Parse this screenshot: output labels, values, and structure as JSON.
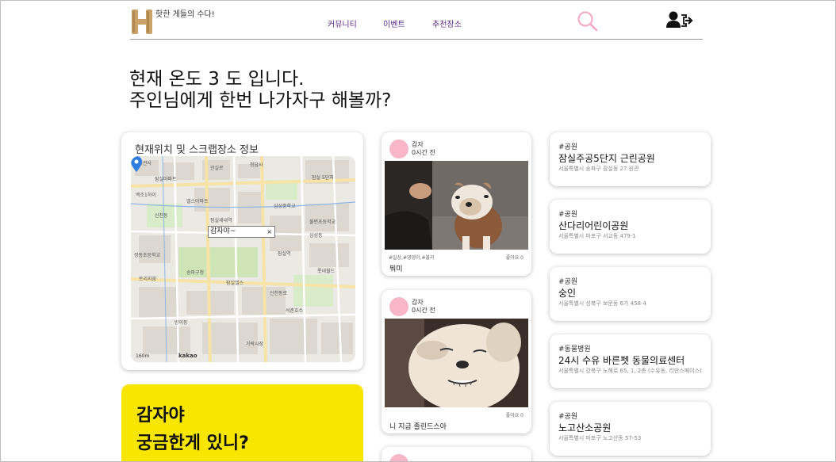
{
  "header": {
    "tagline": "핫한 게들의 수다!",
    "nav": [
      "커뮤니티",
      "이벤트",
      "추천장소"
    ],
    "colors": {
      "nav": "#5b2a86",
      "logo": "#c8a268",
      "search": "#f5a7bf"
    }
  },
  "greeting": {
    "line1": "현재 온도 3 도 입니다.",
    "line2": "주인님에게 한번 나가자구 해볼까?"
  },
  "map_card": {
    "title": "현재위치 및 스크랩장소 정보",
    "info_label": "감자야~",
    "info_close": "×",
    "labels": [
      "체육관사",
      "잠실아파트",
      "청담사",
      "백조1하이",
      "관실로",
      "잠실 5단지",
      "엘스아파트",
      "삼성중학교",
      "신천동",
      "잠실새내역",
      "불변초등학교",
      "정동초등학교",
      "삼성동",
      "잠실역",
      "롯데월드",
      "송파구청",
      "트리지움",
      "잠실엘스",
      "신천동로",
      "방이동",
      "석촌호수",
      "가락시장"
    ],
    "scale": "160m",
    "kakao": "kakao"
  },
  "yellow_card": {
    "line1": "감자야",
    "line2": "궁금한게 있니?",
    "color": "#f7e600"
  },
  "posts": [
    {
      "author": "감자",
      "time": "0시간 전",
      "tags": "#일상,#댕댕이,#불리",
      "likes": "좋아요 0",
      "text": "뭐미"
    },
    {
      "author": "감자",
      "time": "0시간 전",
      "tags": "",
      "likes": "좋아요 0",
      "text": "니 지금 졸린드스아"
    }
  ],
  "places": [
    {
      "category": "#공원",
      "name": "잠실주공5단지 근린공원",
      "address": "서울특별시 송파구 잠실동 27 원관"
    },
    {
      "category": "#공원",
      "name": "산다리어린이공원",
      "address": "서울특별시 마포구 서교동 479-1"
    },
    {
      "category": "#공원",
      "name": "숭인",
      "address": "서울특별시 성북구 보문동 6가 458-4"
    },
    {
      "category": "#동물병원",
      "name": "24시 수유 바른펫 동물의료센터",
      "address": "서울특별시 강북구 노해로 65, 1, 2층 (수유동, 리만스페이스)"
    },
    {
      "category": "#공원",
      "name": "노고산소공원",
      "address": "서울특별시 마포구 노고산동 57-53"
    }
  ]
}
